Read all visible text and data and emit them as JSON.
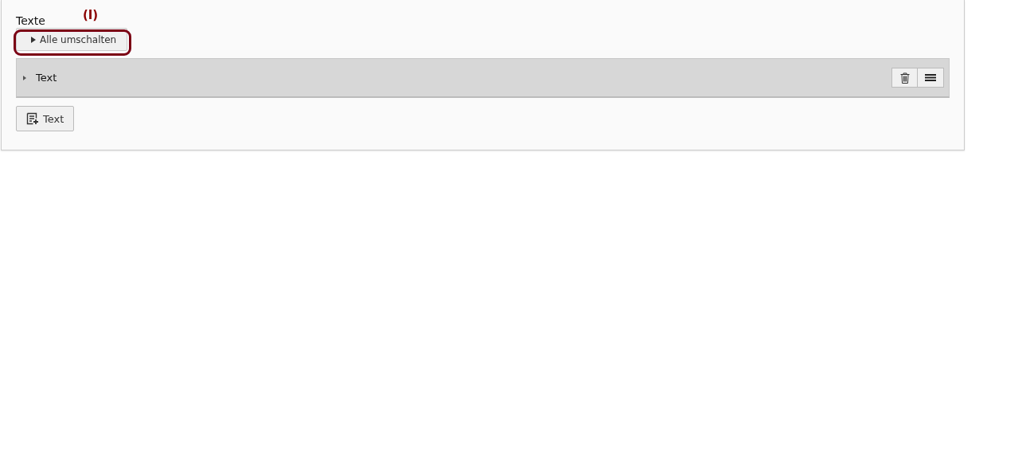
{
  "section": {
    "label": "Texte",
    "annotation": "(I)",
    "toggle_button": {
      "label": "Alle umschalten",
      "highlighted": true
    },
    "items": [
      {
        "title": "Text",
        "expanded": false
      }
    ],
    "add_button": {
      "label": "Text"
    }
  }
}
